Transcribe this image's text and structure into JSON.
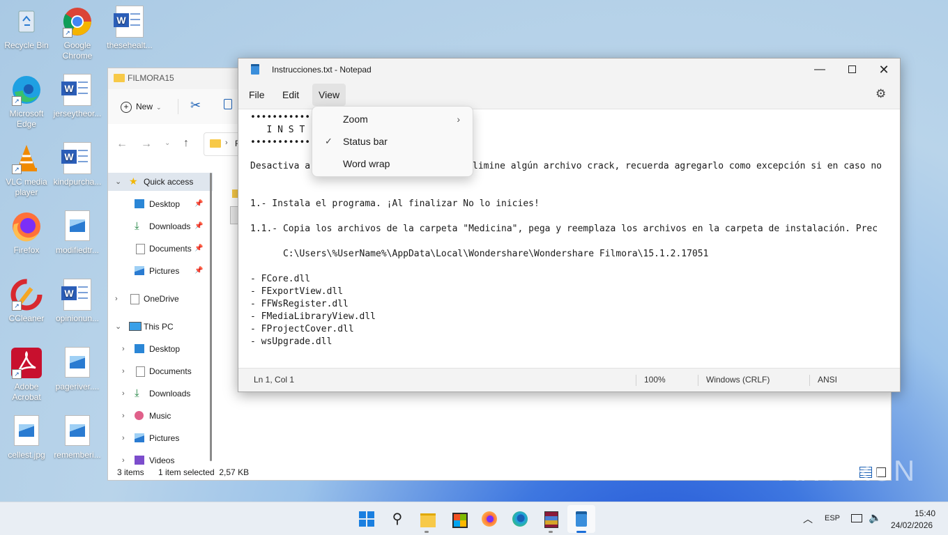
{
  "desktop": {
    "icons": [
      {
        "label": "Recycle Bin",
        "icon": "recycle-bin-icon"
      },
      {
        "label": "Google Chrome",
        "icon": "chrome-icon"
      },
      {
        "label": "thesehealt...",
        "icon": "word-document-icon"
      },
      {
        "label": "Microsoft Edge",
        "icon": "edge-icon"
      },
      {
        "label": "jerseytheor...",
        "icon": "word-document-icon"
      },
      {
        "label": "VLC media player",
        "icon": "vlc-icon"
      },
      {
        "label": "kindpurcha...",
        "icon": "word-document-icon"
      },
      {
        "label": "Firefox",
        "icon": "firefox-icon"
      },
      {
        "label": "modifiedtr...",
        "icon": "image-file-icon"
      },
      {
        "label": "CCleaner",
        "icon": "ccleaner-icon"
      },
      {
        "label": "opinionun...",
        "icon": "word-document-icon"
      },
      {
        "label": "Adobe Acrobat",
        "icon": "acrobat-icon"
      },
      {
        "label": "pageriver....",
        "icon": "image-file-icon"
      },
      {
        "label": "cellest.jpg",
        "icon": "image-file-icon"
      },
      {
        "label": "rememberi...",
        "icon": "image-file-icon"
      }
    ]
  },
  "explorer": {
    "title": "FILMORA15",
    "new_label": "New",
    "address_fragment": "F",
    "nav": [
      {
        "label": "Quick access",
        "icon": "star-icon"
      },
      {
        "label": "Desktop",
        "icon": "desktop-folder-icon"
      },
      {
        "label": "Downloads",
        "icon": "download-icon"
      },
      {
        "label": "Documents",
        "icon": "documents-icon"
      },
      {
        "label": "Pictures",
        "icon": "pictures-icon"
      },
      {
        "label": "OneDrive",
        "icon": "onedrive-icon"
      },
      {
        "label": "This PC",
        "icon": "this-pc-icon"
      },
      {
        "label": "Desktop",
        "icon": "desktop-folder-icon"
      },
      {
        "label": "Documents",
        "icon": "documents-icon"
      },
      {
        "label": "Downloads",
        "icon": "download-icon"
      },
      {
        "label": "Music",
        "icon": "music-icon"
      },
      {
        "label": "Pictures",
        "icon": "pictures-icon"
      },
      {
        "label": "Videos",
        "icon": "videos-icon"
      }
    ],
    "status": {
      "items": "3 items",
      "selected": "1 item selected  2,57 KB"
    }
  },
  "notepad": {
    "title": "Instrucciones.txt - Notepad",
    "menu": {
      "file": "File",
      "edit": "Edit",
      "view": "View"
    },
    "view_menu": {
      "zoom": "Zoom",
      "status_bar": "Status bar",
      "word_wrap": "Word wrap",
      "status_bar_checked": true
    },
    "lines": [
      "•••••••••••",
      "   I N S T",
      "•••••••••••",
      "",
      "Desactiva ar",
      "limine algún archivo crack, recuerda agregarlo como excepción si en caso no",
      "1.- Instala el programa. ¡Al finalizar No lo inicies!",
      "1.1.- Copia los archivos de la carpeta \"Medicina\", pega y reemplaza los archivos en la carpeta de instalación. Prec",
      "      C:\\Users\\%UserName%\\AppData\\Local\\Wondershare\\Wondershare Filmora\\15.1.2.17051",
      "- FCore.dll",
      "- FExportView.dll",
      "- FFWsRegister.dll",
      "- FMediaLibraryView.dll",
      "- FProjectCover.dll",
      "- wsUpgrade.dll"
    ],
    "status": {
      "position": "Ln 1, Col 1",
      "zoom": "100%",
      "line_ending": "Windows (CRLF)",
      "encoding": "ANSI"
    }
  },
  "taskbar": {
    "apps": [
      "start-icon",
      "search-icon",
      "file-explorer-icon",
      "store-icon",
      "firefox-icon",
      "edge-icon",
      "winrar-icon",
      "notepad-icon"
    ],
    "language": "ESP",
    "time": "15:40",
    "date": "24/02/2026"
  },
  "watermark": "ANY RUN"
}
